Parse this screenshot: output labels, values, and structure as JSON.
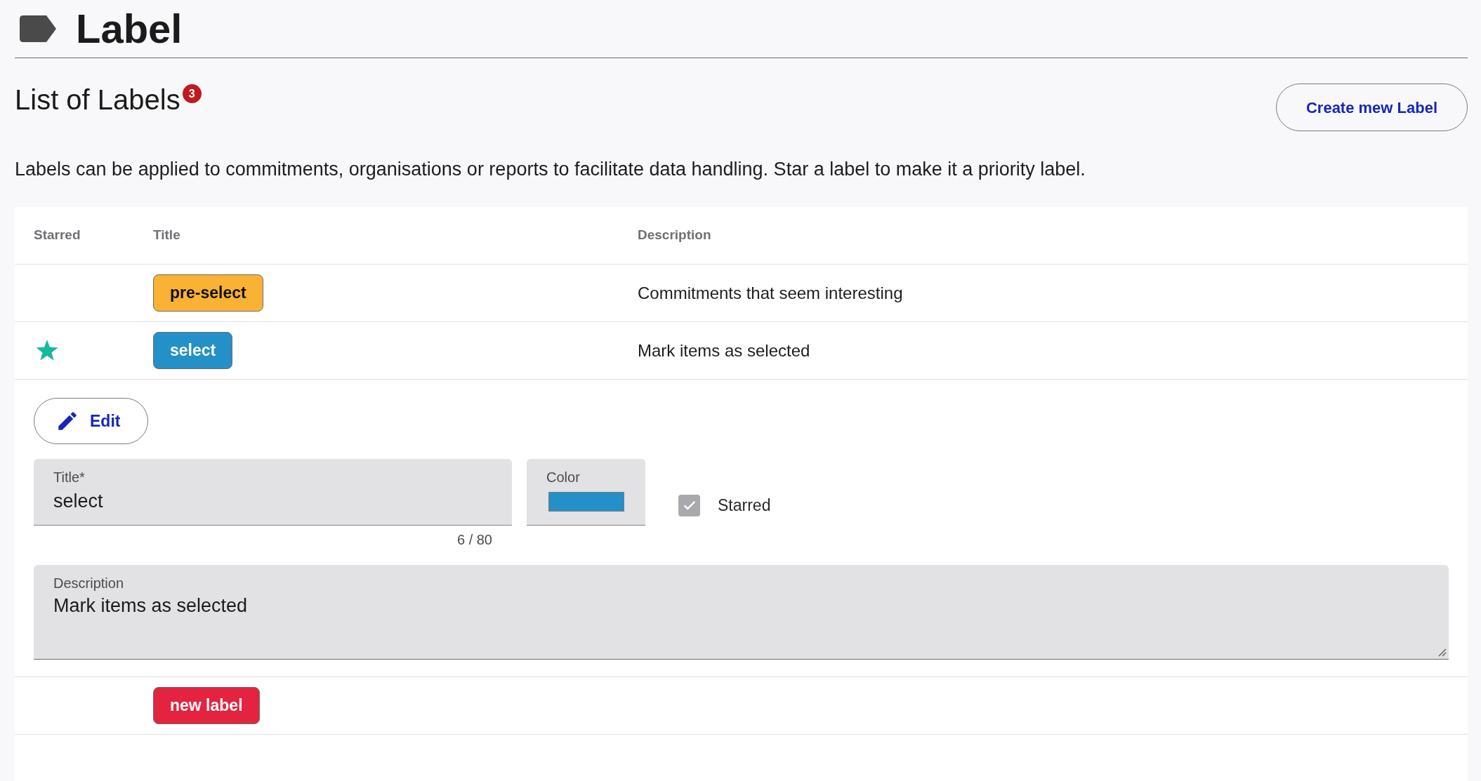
{
  "header": {
    "title": "Label"
  },
  "section": {
    "title": "List of Labels",
    "count_badge": "3",
    "create_button": "Create mew Label",
    "intro": "Labels can be applied to commitments, organisations or reports to facilitate data handling. Star a label to make it a priority label."
  },
  "table": {
    "columns": [
      "Starred",
      "Title",
      "Description"
    ],
    "rows": [
      {
        "starred": false,
        "title": "pre-select",
        "color": "#f9b233",
        "description": "Commitments that seem interesting"
      },
      {
        "starred": true,
        "title": "select",
        "color": "#2390c8",
        "description": "Mark items as selected",
        "editor": {
          "edit_button": "Edit",
          "title_field": {
            "label": "Title*",
            "value": "select",
            "counter": "6 / 80"
          },
          "color_field": {
            "label": "Color",
            "color": "#2390c8"
          },
          "starred_checkbox": {
            "label": "Starred",
            "checked": true,
            "disabled": true
          },
          "description_field": {
            "label": "Description",
            "value": "Mark items as selected"
          }
        }
      },
      {
        "starred": false,
        "title": "new label",
        "color": "#e3233f"
      }
    ]
  }
}
